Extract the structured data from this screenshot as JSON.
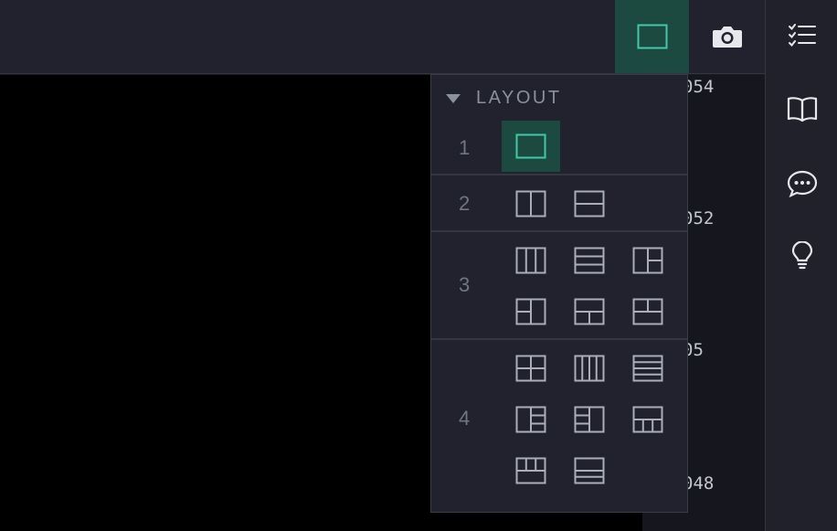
{
  "toolbar": {
    "layout_icon": "single-pane-icon",
    "camera_icon": "camera-icon"
  },
  "axis_ticks": [
    "054",
    "052",
    "05",
    "048"
  ],
  "sidebar": {
    "items": [
      {
        "icon": "checklist-icon"
      },
      {
        "icon": "book-icon"
      },
      {
        "icon": "chat-icon"
      },
      {
        "icon": "lightbulb-icon"
      }
    ]
  },
  "layout_menu": {
    "title": "LAYOUT",
    "rows": [
      {
        "count": "1",
        "selected_index": 0
      },
      {
        "count": "2"
      },
      {
        "count": "3"
      },
      {
        "count": "4"
      }
    ]
  },
  "colors": {
    "accent": "#3fc9a8",
    "selected_bg": "#1d4a40",
    "icon_gray": "#a9aeb8"
  }
}
